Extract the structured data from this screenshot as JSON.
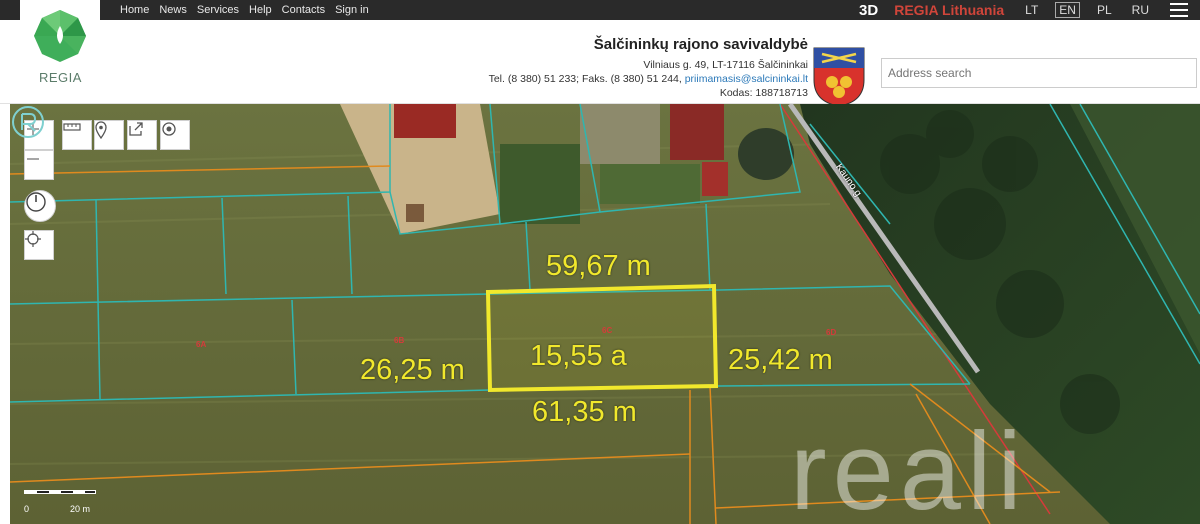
{
  "topbar": {
    "nav": [
      {
        "label": "Home"
      },
      {
        "label": "News"
      },
      {
        "label": "Services"
      },
      {
        "label": "Help"
      },
      {
        "label": "Contacts"
      },
      {
        "label": "Sign in"
      }
    ],
    "threed_label": "3D",
    "site_title": "REGIA Lithuania",
    "languages": [
      "LT",
      "EN",
      "PL",
      "RU"
    ],
    "active_language": "EN"
  },
  "logo": {
    "text": "REGIA"
  },
  "municipality": {
    "name": "Šalčininkų rajono savivaldybė",
    "address": "Vilniaus g. 49, LT-17116 Šalčininkai",
    "phone": "Tel. (8 380) 51 233; Faks. (8 380) 51 244,",
    "email": "priimamasis@salcininkai.lt",
    "code": "Kodas: 188718713"
  },
  "search": {
    "placeholder": "Address search"
  },
  "map": {
    "measurements": {
      "top": "59,67 m",
      "left": "26,25 m",
      "area": "15,55 a",
      "right": "25,42 m",
      "bottom": "61,35 m"
    },
    "plot_labels": [
      "6A",
      "6B",
      "6C",
      "6D"
    ],
    "street": "Kauno g.",
    "scale": {
      "start": "0",
      "end": "20 m"
    },
    "watermark": "reali"
  },
  "colors": {
    "topbar": "#2a2a2a",
    "highlight": "#f1e82c",
    "parcel_line": "#2fb6b0",
    "boundary_orange": "#e08a1e",
    "regia_red": "#d0453a"
  }
}
